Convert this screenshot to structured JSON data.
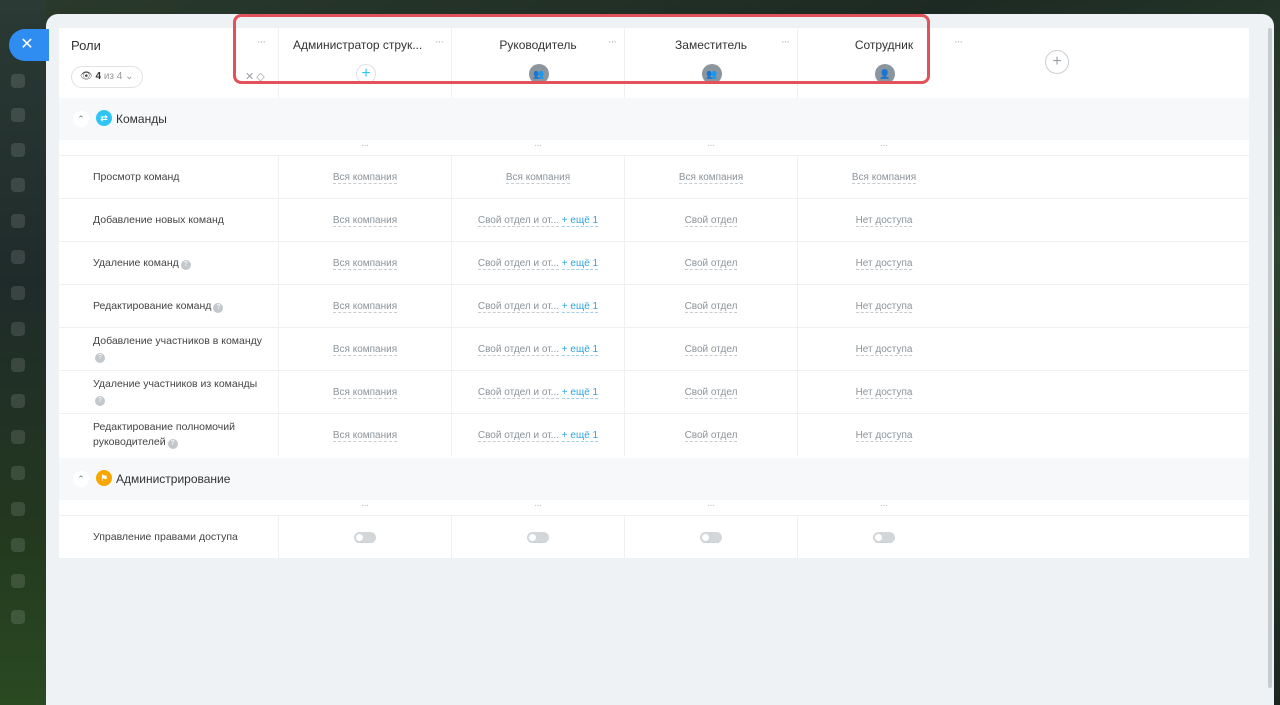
{
  "close_icon": "close-icon",
  "header": {
    "roles_title": "Роли",
    "filter": {
      "count": "4",
      "of_label": "из 4"
    },
    "roles": [
      {
        "name": "Администратор струк...",
        "icon": "plus-icon"
      },
      {
        "name": "Руководитель",
        "icon": "users-icon"
      },
      {
        "name": "Заместитель",
        "icon": "users-icon"
      },
      {
        "name": "Сотрудник",
        "icon": "user-icon"
      }
    ]
  },
  "sections": [
    {
      "title": "Команды",
      "icon_color": "#2fc6f6",
      "rows": [
        {
          "label": "Просмотр команд",
          "help": false,
          "values": [
            "Вся компания",
            "Вся компания",
            "Вся компания",
            "Вся компания"
          ]
        },
        {
          "label": "Добавление новых команд",
          "help": false,
          "values": [
            "Вся компания",
            "Свой отдел и от...",
            "Свой отдел",
            "Нет доступа"
          ],
          "more": "+ ещё 1"
        },
        {
          "label": "Удаление команд",
          "help": true,
          "values": [
            "Вся компания",
            "Свой отдел и от...",
            "Свой отдел",
            "Нет доступа"
          ],
          "more": "+ ещё 1"
        },
        {
          "label": "Редактирование команд",
          "help": true,
          "values": [
            "Вся компания",
            "Свой отдел и от...",
            "Свой отдел",
            "Нет доступа"
          ],
          "more": "+ ещё 1"
        },
        {
          "label": "Добавление участников в команду",
          "help": true,
          "values": [
            "Вся компания",
            "Свой отдел и от...",
            "Свой отдел",
            "Нет доступа"
          ],
          "more": "+ ещё 1"
        },
        {
          "label": "Удаление участников из команды",
          "help": true,
          "values": [
            "Вся компания",
            "Свой отдел и от...",
            "Свой отдел",
            "Нет доступа"
          ],
          "more": "+ ещё 1"
        },
        {
          "label": "Редактирование полномочий руководителей",
          "help": true,
          "values": [
            "Вся компания",
            "Свой отдел и от...",
            "Свой отдел",
            "Нет доступа"
          ],
          "more": "+ ещё 1"
        }
      ]
    },
    {
      "title": "Администрирование",
      "icon_color": "#f7a700",
      "rows": [
        {
          "label": "Управление правами доступа",
          "help": false,
          "toggles": [
            false,
            false,
            false,
            false
          ]
        }
      ]
    }
  ],
  "ellipsis": "···",
  "help_glyph": "?"
}
